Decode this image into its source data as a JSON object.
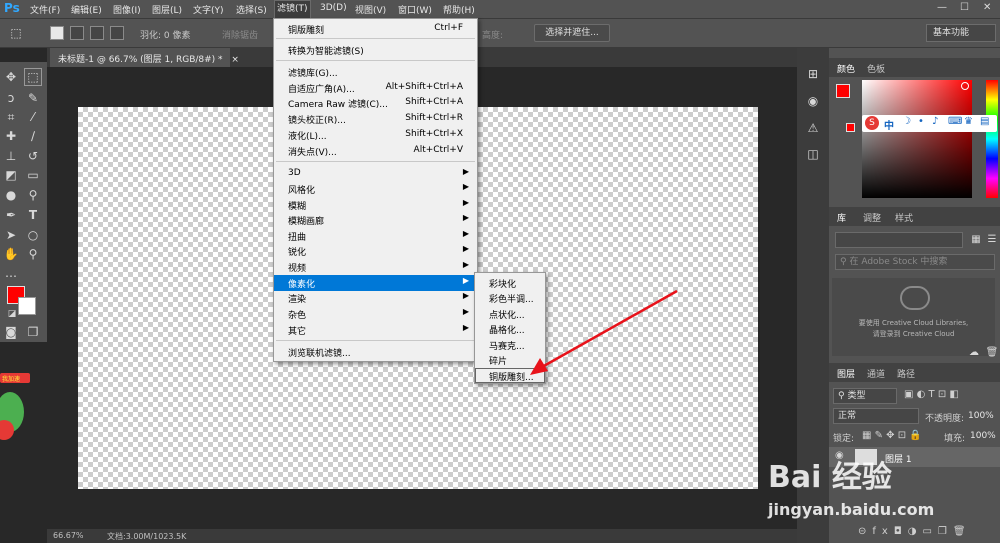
{
  "app": {
    "logo": "Ps"
  },
  "menubar": {
    "items": [
      "文件(F)",
      "编辑(E)",
      "图像(I)",
      "图层(L)",
      "文字(Y)",
      "选择(S)",
      "滤镜(T)",
      "3D(D)",
      "视图(V)",
      "窗口(W)",
      "帮助(H)"
    ],
    "active_index": 6,
    "window_controls": [
      "—",
      "☐",
      "✕"
    ]
  },
  "options_bar": {
    "feather_label": "羽化: 0 像素",
    "antialias_label": "消除锯齿",
    "height_label": "高度:",
    "select_mask_button": "选择并遮住...",
    "workspace": "基本功能"
  },
  "document": {
    "tab_title": "未标题-1 @ 66.7% (图层 1, RGB/8#) *",
    "close": "×",
    "zoom": "66.67%",
    "doc_info": "文档:3.00M/1023.5K"
  },
  "filter_menu": {
    "items": [
      {
        "label": "铜版雕刻",
        "shortcut": "Ctrl+F"
      },
      {
        "label": "转换为智能滤镜(S)",
        "shortcut": ""
      },
      {
        "label": "滤镜库(G)...",
        "shortcut": ""
      },
      {
        "label": "自适应广角(A)...",
        "shortcut": "Alt+Shift+Ctrl+A"
      },
      {
        "label": "Camera Raw 滤镜(C)...",
        "shortcut": "Shift+Ctrl+A"
      },
      {
        "label": "镜头校正(R)...",
        "shortcut": "Shift+Ctrl+R"
      },
      {
        "label": "液化(L)...",
        "shortcut": "Shift+Ctrl+X"
      },
      {
        "label": "消失点(V)...",
        "shortcut": "Alt+Ctrl+V"
      },
      {
        "label": "3D",
        "shortcut": ""
      },
      {
        "label": "风格化",
        "shortcut": ""
      },
      {
        "label": "模糊",
        "shortcut": ""
      },
      {
        "label": "模糊画廊",
        "shortcut": ""
      },
      {
        "label": "扭曲",
        "shortcut": ""
      },
      {
        "label": "锐化",
        "shortcut": ""
      },
      {
        "label": "视频",
        "shortcut": ""
      },
      {
        "label": "像素化",
        "shortcut": ""
      },
      {
        "label": "渲染",
        "shortcut": ""
      },
      {
        "label": "杂色",
        "shortcut": ""
      },
      {
        "label": "其它",
        "shortcut": ""
      },
      {
        "label": "浏览联机滤镜...",
        "shortcut": ""
      }
    ],
    "highlighted_index": 15
  },
  "pixelate_submenu": {
    "items": [
      "彩块化",
      "彩色半调...",
      "点状化...",
      "晶格化...",
      "马赛克...",
      "碎片",
      "铜版雕刻..."
    ],
    "boxed_index": 6
  },
  "panels": {
    "color_tabs": [
      "颜色",
      "色板"
    ],
    "library_tabs": [
      "库",
      "调整",
      "样式"
    ],
    "library_search_placeholder": "在 Adobe Stock 中搜索",
    "cc_text_1": "要使用 Creative Cloud Libraries,",
    "cc_text_2": "请登录到 Creative Cloud",
    "layers_tabs": [
      "图层",
      "通道",
      "路径"
    ],
    "layer_filter": "类型",
    "blend_mode": "正常",
    "opacity_label": "不透明度:",
    "opacity_value": "100%",
    "lock_label": "锁定:",
    "fill_label": "填充:",
    "fill_value": "100%",
    "layer_name": "图层 1",
    "ime_bar_glyph": "中"
  },
  "watermark": {
    "main": "Bai 经验",
    "sub": "jingyan.baidu.com"
  },
  "mascot": {
    "label": "我加速"
  },
  "colors": {
    "foreground": "#ff0000",
    "background": "#ffffff",
    "highlight": "#0078d7",
    "arrow": "#e8121a"
  }
}
